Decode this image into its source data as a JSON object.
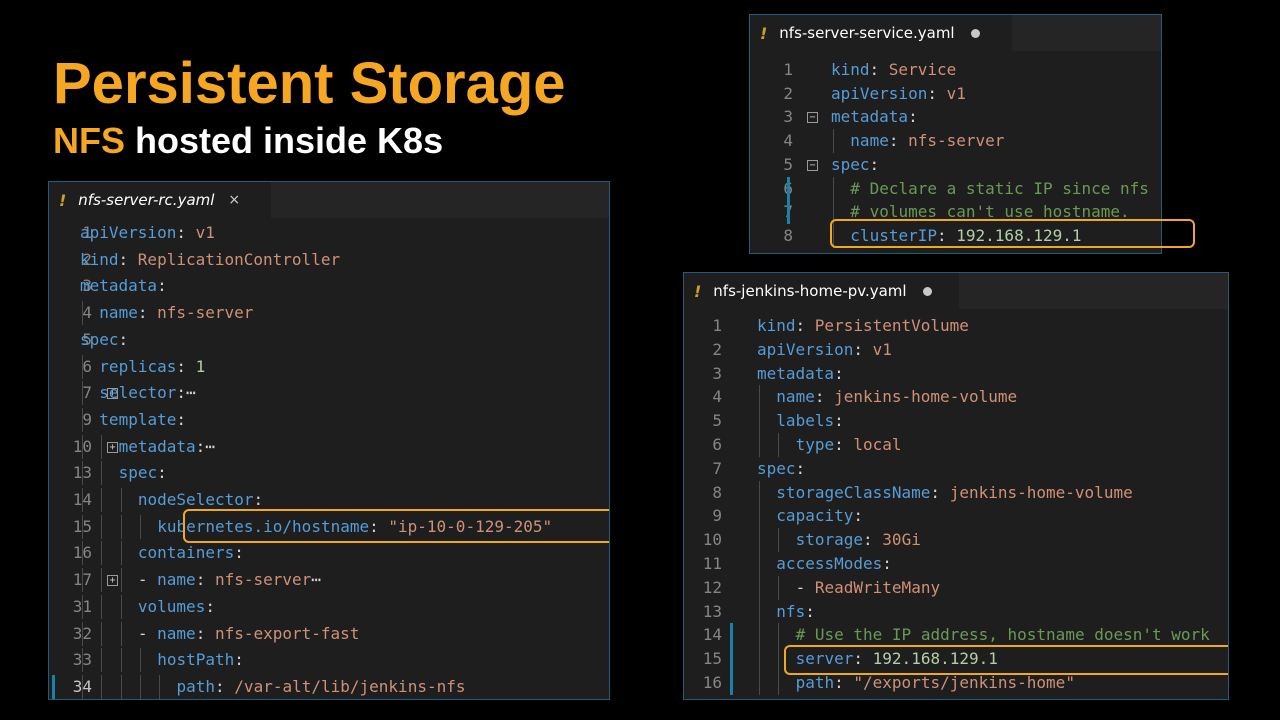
{
  "slide": {
    "title": "Persistent Storage",
    "subtitle_accent": "NFS",
    "subtitle_rest": "hosted inside K8s"
  },
  "colors": {
    "accent": "#f5a623",
    "highlight": "#f0a91c",
    "key": "#569cd6",
    "string": "#ce9178",
    "number": "#b5cea8",
    "comment": "#6a9955"
  },
  "editors": [
    {
      "tab_icon": "!",
      "tab_name": "nfs-server-rc.yaml",
      "tab_control": "×",
      "lines": [
        {
          "n": "1",
          "i": 0,
          "t": [
            [
              "k",
              "apiVersion"
            ],
            [
              "p",
              ": "
            ],
            [
              "v",
              "v1"
            ]
          ]
        },
        {
          "n": "2",
          "i": 0,
          "t": [
            [
              "k",
              "kind"
            ],
            [
              "p",
              ": "
            ],
            [
              "v",
              "ReplicationController"
            ]
          ]
        },
        {
          "n": "3",
          "i": 0,
          "t": [
            [
              "k",
              "metadata"
            ],
            [
              "p",
              ":"
            ]
          ]
        },
        {
          "n": "4",
          "i": 1,
          "t": [
            [
              "k",
              "name"
            ],
            [
              "p",
              ": "
            ],
            [
              "v",
              "nfs-server"
            ]
          ]
        },
        {
          "n": "5",
          "i": 0,
          "t": [
            [
              "k",
              "spec"
            ],
            [
              "p",
              ":"
            ]
          ]
        },
        {
          "n": "6",
          "i": 1,
          "t": [
            [
              "k",
              "replicas"
            ],
            [
              "p",
              ": "
            ],
            [
              "n",
              "1"
            ]
          ]
        },
        {
          "n": "7",
          "i": 1,
          "fold": "+",
          "t": [
            [
              "k",
              "selector"
            ],
            [
              "p",
              ":⋯"
            ]
          ]
        },
        {
          "n": "9",
          "i": 1,
          "t": [
            [
              "k",
              "template"
            ],
            [
              "p",
              ":"
            ]
          ]
        },
        {
          "n": "10",
          "i": 2,
          "fold": "+",
          "t": [
            [
              "k",
              "metadata"
            ],
            [
              "p",
              ":⋯"
            ]
          ]
        },
        {
          "n": "13",
          "i": 2,
          "t": [
            [
              "k",
              "spec"
            ],
            [
              "p",
              ":"
            ]
          ]
        },
        {
          "n": "14",
          "i": 3,
          "t": [
            [
              "k",
              "nodeSelector"
            ],
            [
              "p",
              ":"
            ]
          ]
        },
        {
          "n": "15",
          "i": 4,
          "t": [
            [
              "k",
              "kubernetes.io/hostname"
            ],
            [
              "p",
              ": "
            ],
            [
              "v",
              "\"ip-10-0-129-205\""
            ]
          ]
        },
        {
          "n": "16",
          "i": 3,
          "t": [
            [
              "k",
              "containers"
            ],
            [
              "p",
              ":"
            ]
          ]
        },
        {
          "n": "17",
          "i": 3,
          "fold": "+",
          "t": [
            [
              "p",
              "- "
            ],
            [
              "k",
              "name"
            ],
            [
              "p",
              ": "
            ],
            [
              "v",
              "nfs-server"
            ],
            [
              "p",
              "⋯"
            ]
          ]
        },
        {
          "n": "31",
          "i": 3,
          "t": [
            [
              "k",
              "volumes"
            ],
            [
              "p",
              ":"
            ]
          ]
        },
        {
          "n": "32",
          "i": 3,
          "t": [
            [
              "p",
              "- "
            ],
            [
              "k",
              "name"
            ],
            [
              "p",
              ": "
            ],
            [
              "v",
              "nfs-export-fast"
            ]
          ]
        },
        {
          "n": "33",
          "i": 4,
          "t": [
            [
              "k",
              "hostPath"
            ],
            [
              "p",
              ":"
            ]
          ]
        },
        {
          "n": "34",
          "i": 5,
          "cur": true,
          "mod": true,
          "t": [
            [
              "k",
              "path"
            ],
            [
              "p",
              ": "
            ],
            [
              "v",
              "/var-alt/lib/jenkins-nfs"
            ]
          ]
        }
      ]
    },
    {
      "tab_icon": "!",
      "tab_name": "nfs-server-service.yaml",
      "lines": [
        {
          "n": "1",
          "i": 0,
          "t": [
            [
              "k",
              "kind"
            ],
            [
              "p",
              ": "
            ],
            [
              "v",
              "Service"
            ]
          ]
        },
        {
          "n": "2",
          "i": 0,
          "t": [
            [
              "k",
              "apiVersion"
            ],
            [
              "p",
              ": "
            ],
            [
              "v",
              "v1"
            ]
          ]
        },
        {
          "n": "3",
          "i": 0,
          "fold": "−",
          "t": [
            [
              "k",
              "metadata"
            ],
            [
              "p",
              ":"
            ]
          ]
        },
        {
          "n": "4",
          "i": 1,
          "t": [
            [
              "k",
              "name"
            ],
            [
              "p",
              ": "
            ],
            [
              "v",
              "nfs-server"
            ]
          ]
        },
        {
          "n": "5",
          "i": 0,
          "fold": "−",
          "t": [
            [
              "k",
              "spec"
            ],
            [
              "p",
              ":"
            ]
          ]
        },
        {
          "n": "6",
          "i": 1,
          "mod": true,
          "t": [
            [
              "c",
              "# Declare a static IP since nfs"
            ]
          ]
        },
        {
          "n": "7",
          "i": 1,
          "mod": true,
          "t": [
            [
              "c",
              "# volumes can't use hostname."
            ]
          ]
        },
        {
          "n": "8",
          "i": 1,
          "t": [
            [
              "k",
              "clusterIP"
            ],
            [
              "p",
              ": "
            ],
            [
              "n",
              "192.168.129.1"
            ]
          ]
        }
      ]
    },
    {
      "tab_icon": "!",
      "tab_name": "nfs-jenkins-home-pv.yaml",
      "lines": [
        {
          "n": "1",
          "i": 0,
          "t": [
            [
              "k",
              "kind"
            ],
            [
              "p",
              ": "
            ],
            [
              "v",
              "PersistentVolume"
            ]
          ]
        },
        {
          "n": "2",
          "i": 0,
          "t": [
            [
              "k",
              "apiVersion"
            ],
            [
              "p",
              ": "
            ],
            [
              "v",
              "v1"
            ]
          ]
        },
        {
          "n": "3",
          "i": 0,
          "t": [
            [
              "k",
              "metadata"
            ],
            [
              "p",
              ":"
            ]
          ]
        },
        {
          "n": "4",
          "i": 1,
          "t": [
            [
              "k",
              "name"
            ],
            [
              "p",
              ": "
            ],
            [
              "v",
              "jenkins-home-volume"
            ]
          ]
        },
        {
          "n": "5",
          "i": 1,
          "t": [
            [
              "k",
              "labels"
            ],
            [
              "p",
              ":"
            ]
          ]
        },
        {
          "n": "6",
          "i": 2,
          "t": [
            [
              "k",
              "type"
            ],
            [
              "p",
              ": "
            ],
            [
              "v",
              "local"
            ]
          ]
        },
        {
          "n": "7",
          "i": 0,
          "t": [
            [
              "k",
              "spec"
            ],
            [
              "p",
              ":"
            ]
          ]
        },
        {
          "n": "8",
          "i": 1,
          "t": [
            [
              "k",
              "storageClassName"
            ],
            [
              "p",
              ": "
            ],
            [
              "v",
              "jenkins-home-volume"
            ]
          ]
        },
        {
          "n": "9",
          "i": 1,
          "t": [
            [
              "k",
              "capacity"
            ],
            [
              "p",
              ":"
            ]
          ]
        },
        {
          "n": "10",
          "i": 2,
          "t": [
            [
              "k",
              "storage"
            ],
            [
              "p",
              ": "
            ],
            [
              "v",
              "30Gi"
            ]
          ]
        },
        {
          "n": "11",
          "i": 1,
          "t": [
            [
              "k",
              "accessModes"
            ],
            [
              "p",
              ":"
            ]
          ]
        },
        {
          "n": "12",
          "i": 2,
          "t": [
            [
              "p",
              "- "
            ],
            [
              "v",
              "ReadWriteMany"
            ]
          ]
        },
        {
          "n": "13",
          "i": 1,
          "t": [
            [
              "k",
              "nfs"
            ],
            [
              "p",
              ":"
            ]
          ]
        },
        {
          "n": "14",
          "i": 2,
          "mod": true,
          "t": [
            [
              "c",
              "# Use the IP address, hostname doesn't work"
            ]
          ]
        },
        {
          "n": "15",
          "i": 2,
          "mod": true,
          "t": [
            [
              "k",
              "server"
            ],
            [
              "p",
              ": "
            ],
            [
              "n",
              "192.168.129.1"
            ]
          ]
        },
        {
          "n": "16",
          "i": 2,
          "mod": true,
          "t": [
            [
              "k",
              "path"
            ],
            [
              "p",
              ": "
            ],
            [
              "v",
              "\"/exports/jenkins-home\""
            ]
          ]
        }
      ]
    }
  ]
}
